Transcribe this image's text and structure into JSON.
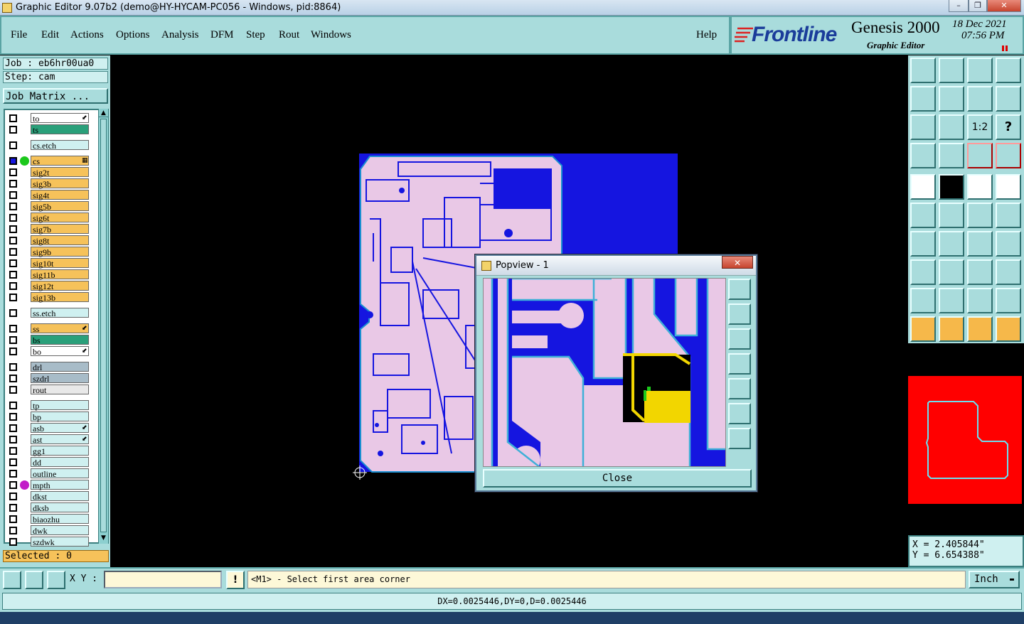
{
  "window": {
    "title": "Graphic Editor 9.07b2 (demo@HY-HYCAM-PC056 - Windows, pid:8864)",
    "buttons": [
      "–",
      "❐",
      "✕"
    ]
  },
  "menu": {
    "items": [
      "File",
      "Edit",
      "Actions",
      "Options",
      "Analysis",
      "DFM",
      "Step",
      "Rout",
      "Windows"
    ],
    "help": "Help"
  },
  "brand": {
    "logo": "Frontline",
    "product": "Genesis 2000",
    "subtitle": "Graphic Editor",
    "date": "18 Dec 2021",
    "time": "07:56 PM",
    "logo_color": "#d22"
  },
  "left": {
    "job": "Job : eb6hr00ua0",
    "step": "Step: cam",
    "matrix_button": "Job Matrix ...",
    "selected": "Selected : 0"
  },
  "layers": [
    {
      "name": "to",
      "color": "#ffffff",
      "marker": "⬋"
    },
    {
      "name": "ts",
      "color": "#2aa07a",
      "marker": ""
    },
    {
      "name": "cs.etch",
      "color": "#cff0f0",
      "marker": ""
    },
    {
      "name": "cs",
      "color": "#f6c25a",
      "marker": "▦",
      "work": true,
      "dot": "#1cc81c"
    },
    {
      "name": "sig2t",
      "color": "#f6c25a",
      "marker": ""
    },
    {
      "name": "sig3b",
      "color": "#f6c25a",
      "marker": ""
    },
    {
      "name": "sig4t",
      "color": "#f6c25a",
      "marker": ""
    },
    {
      "name": "sig5b",
      "color": "#f6c25a",
      "marker": ""
    },
    {
      "name": "sig6t",
      "color": "#f6c25a",
      "marker": ""
    },
    {
      "name": "sig7b",
      "color": "#f6c25a",
      "marker": ""
    },
    {
      "name": "sig8t",
      "color": "#f6c25a",
      "marker": ""
    },
    {
      "name": "sig9b",
      "color": "#f6c25a",
      "marker": ""
    },
    {
      "name": "sig10t",
      "color": "#f6c25a",
      "marker": ""
    },
    {
      "name": "sig11b",
      "color": "#f6c25a",
      "marker": ""
    },
    {
      "name": "sig12t",
      "color": "#f6c25a",
      "marker": ""
    },
    {
      "name": "sig13b",
      "color": "#f6c25a",
      "marker": ""
    },
    {
      "name": "ss.etch",
      "color": "#cff0f0",
      "marker": ""
    },
    {
      "name": "ss",
      "color": "#f6c25a",
      "marker": "⬋"
    },
    {
      "name": "bs",
      "color": "#2aa07a",
      "marker": ""
    },
    {
      "name": "bo",
      "color": "#ffffff",
      "marker": "⬋"
    },
    {
      "name": "drl",
      "color": "#a8bcc8",
      "marker": ""
    },
    {
      "name": "szdrl",
      "color": "#a8bcc8",
      "marker": ""
    },
    {
      "name": "rout",
      "color": "#e8e8e8",
      "marker": ""
    },
    {
      "name": "tp",
      "color": "#cff0f0",
      "marker": ""
    },
    {
      "name": "bp",
      "color": "#cff0f0",
      "marker": ""
    },
    {
      "name": "asb",
      "color": "#cff0f0",
      "marker": "⬋"
    },
    {
      "name": "ast",
      "color": "#cff0f0",
      "marker": "⬋"
    },
    {
      "name": "gg1",
      "color": "#cff0f0",
      "marker": ""
    },
    {
      "name": "dd",
      "color": "#cff0f0",
      "marker": ""
    },
    {
      "name": "outline",
      "color": "#cff0f0",
      "marker": ""
    },
    {
      "name": "mpth",
      "color": "#cff0f0",
      "marker": "",
      "dot": "#c21cc8"
    },
    {
      "name": "dkst",
      "color": "#cff0f0",
      "marker": ""
    },
    {
      "name": "dksb",
      "color": "#cff0f0",
      "marker": ""
    },
    {
      "name": "biaozhu",
      "color": "#cff0f0",
      "marker": ""
    },
    {
      "name": "dwk",
      "color": "#cff0f0",
      "marker": ""
    },
    {
      "name": "szdwk",
      "color": "#cff0f0",
      "marker": ""
    }
  ],
  "popview": {
    "title": "Popview - 1",
    "close_label": "Close",
    "close_x": "✕"
  },
  "coords": {
    "x": "X = 2.405844\"",
    "y": "Y = 6.654388\""
  },
  "command": {
    "xy_label": "X Y :",
    "xy_value": "",
    "prompt": "<M1> - Select first area corner",
    "units": "Inch"
  },
  "status": {
    "text": "DX=0.0025446,DY=0,D=0.0025446"
  },
  "colors": {
    "panel": "#a9dcdc",
    "board_fill": "#e9c8e6",
    "board_bg": "#1515e0",
    "highlight": "#f2d600",
    "overview_profile": "#ff0000"
  }
}
